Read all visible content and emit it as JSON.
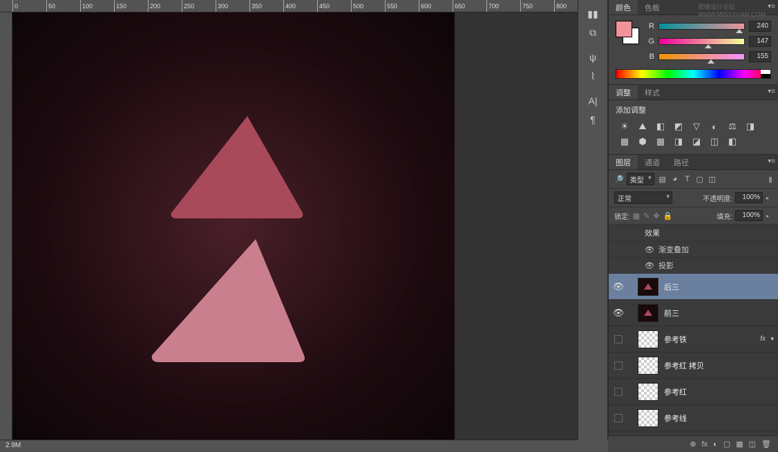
{
  "watermark": "思缘设计论坛  WWW.MISSYUAN.COM",
  "ruler": {
    "marks": [
      0,
      50,
      100,
      150,
      200,
      250,
      300,
      350,
      400,
      450,
      500,
      550,
      600,
      650,
      700,
      750,
      800
    ]
  },
  "status": {
    "zoom": "2.9M"
  },
  "color_panel": {
    "tabs": [
      "颜色",
      "色板"
    ],
    "active_tab": 0,
    "channels": [
      {
        "label": "R",
        "value": 240,
        "pct": 94
      },
      {
        "label": "G",
        "value": 147,
        "pct": 58
      },
      {
        "label": "B",
        "value": 155,
        "pct": 61
      }
    ]
  },
  "adjustments_panel": {
    "tabs": [
      "调整",
      "样式"
    ],
    "active_tab": 0,
    "title": "添加调整",
    "icons": [
      "☀",
      "⛰",
      "◧",
      "◩",
      "▽",
      "◐",
      "⚖",
      "◨",
      "▦",
      "⬢",
      "▦",
      "◨",
      "◪",
      "◫",
      "◧"
    ]
  },
  "layers_panel": {
    "tabs": [
      "图层",
      "通道",
      "路径"
    ],
    "active_tab": 0,
    "filter_label": "类型",
    "filter_icons": [
      "▤",
      "◕",
      "T",
      "▢",
      "◫"
    ],
    "blend_mode": "正常",
    "opacity_label": "不透明度:",
    "opacity": "100%",
    "lock_label": "锁定:",
    "fill_label": "填充:",
    "fill": "100%",
    "effects_label": "效果",
    "effects": [
      {
        "name": "渐变叠加",
        "visible": true
      },
      {
        "name": "投影",
        "visible": true
      }
    ],
    "layers": [
      {
        "name": "后三",
        "visible": true,
        "selected": true,
        "thumb": "tri"
      },
      {
        "name": "前三",
        "visible": true,
        "selected": false,
        "thumb": "tri"
      },
      {
        "name": "参考铁",
        "visible": false,
        "selected": false,
        "thumb": "checker",
        "fx": true
      },
      {
        "name": "参考红 拷贝",
        "visible": false,
        "selected": false,
        "thumb": "checker"
      },
      {
        "name": "参考红",
        "visible": false,
        "selected": false,
        "thumb": "checker"
      },
      {
        "name": "参考线",
        "visible": false,
        "selected": false,
        "thumb": "checker"
      }
    ]
  },
  "bottom_icons": [
    "⊕",
    "fx",
    "◐",
    "▢",
    "▦",
    "◫",
    "🗑"
  ]
}
